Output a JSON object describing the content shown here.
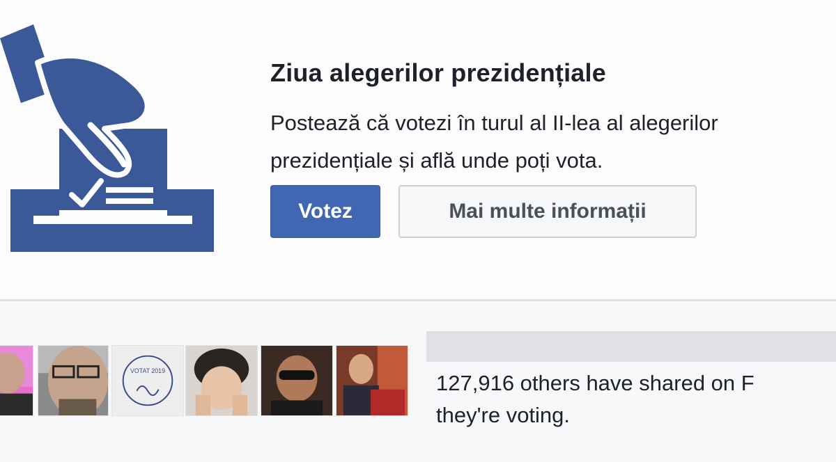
{
  "banner": {
    "title": "Ziua alegerilor prezidențiale",
    "description": "Postează că votezi în turul al II-lea al alegerilor prezidențiale și află unde poți vota.",
    "vote_button_label": "Votez",
    "more_info_button_label": "Mai multe informații",
    "illustration_icon": "ballot-box-hand-icon",
    "accent_color": "#4267b2"
  },
  "social": {
    "avatars": [
      {
        "name": "avatar-1"
      },
      {
        "name": "avatar-2"
      },
      {
        "name": "avatar-3"
      },
      {
        "name": "avatar-4"
      },
      {
        "name": "avatar-5"
      },
      {
        "name": "avatar-6"
      }
    ],
    "stamp_text": "VOTAT 2019",
    "shared_text_line1": "127,916 others have shared on F",
    "shared_text_line2": "they're voting."
  }
}
